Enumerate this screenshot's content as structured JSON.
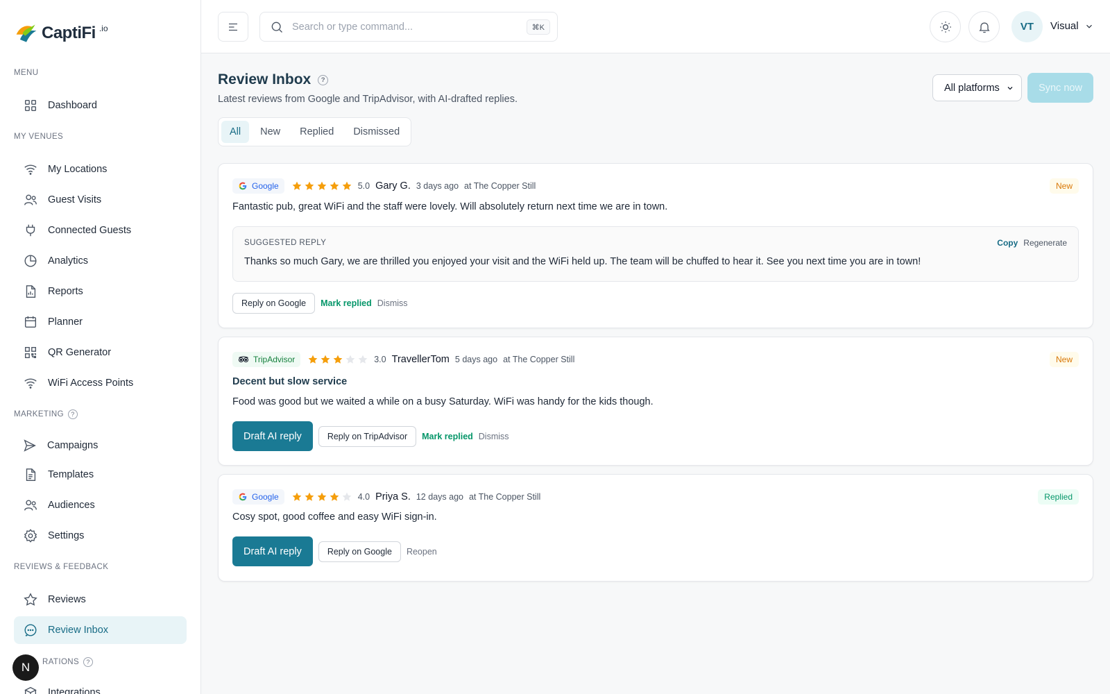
{
  "brand": {
    "name": "CaptiFi",
    "suffix": ".io"
  },
  "sidebar": {
    "sections": [
      {
        "label": "MENU"
      },
      {
        "label": "MY VENUES"
      },
      {
        "label": "MARKETING"
      },
      {
        "label": "REVIEWS & FEEDBACK"
      },
      {
        "label": "RATIONS"
      }
    ],
    "items": [
      {
        "label": "Dashboard",
        "icon": "grid-icon"
      },
      {
        "label": "My Locations",
        "icon": "wifi-icon"
      },
      {
        "label": "Guest Visits",
        "icon": "users-icon"
      },
      {
        "label": "Connected Guests",
        "icon": "plug-icon"
      },
      {
        "label": "Analytics",
        "icon": "pie-chart-icon"
      },
      {
        "label": "Reports",
        "icon": "report-icon"
      },
      {
        "label": "Planner",
        "icon": "calendar-icon"
      },
      {
        "label": "QR Generator",
        "icon": "qr-icon"
      },
      {
        "label": "WiFi Access Points",
        "icon": "wifi-icon"
      },
      {
        "label": "Campaigns",
        "icon": "send-icon"
      },
      {
        "label": "Templates",
        "icon": "template-icon"
      },
      {
        "label": "Audiences",
        "icon": "users-icon"
      },
      {
        "label": "Settings",
        "icon": "gear-icon"
      },
      {
        "label": "Reviews",
        "icon": "star-icon"
      },
      {
        "label": "Review Inbox",
        "icon": "chat-icon",
        "active": true
      },
      {
        "label": "Integrations",
        "icon": "box-icon"
      }
    ],
    "floating_badge": "N"
  },
  "topbar": {
    "search_placeholder": "Search or type command...",
    "shortcut": "⌘K",
    "avatar_initials": "VT",
    "user_name": "Visual"
  },
  "page": {
    "title": "Review Inbox",
    "help": "?",
    "subtitle": "Latest reviews from Google and TripAdvisor, with AI-drafted replies.",
    "platform_filter": "All platforms",
    "sync_label": "Sync now",
    "tabs": [
      {
        "label": "All",
        "active": true
      },
      {
        "label": "New"
      },
      {
        "label": "Replied"
      },
      {
        "label": "Dismissed"
      }
    ]
  },
  "reviews": [
    {
      "platform": "Google",
      "rating": 5,
      "rating_text": "5.0",
      "author": "Gary G.",
      "time": "3 days ago",
      "venue": "at The Copper Still",
      "status": "New",
      "text": "Fantastic pub, great WiFi and the staff were lovely. Will absolutely return next time we are in town.",
      "suggested_label": "SUGGESTED REPLY",
      "suggested_copy": "Copy",
      "suggested_regen": "Regenerate",
      "suggested_text": "Thanks so much Gary, we are thrilled you enjoyed your visit and the WiFi held up. The team will be chuffed to hear it. See you next time you are in town!",
      "reply_label": "Reply on Google",
      "mark_label": "Mark replied",
      "dismiss_label": "Dismiss"
    },
    {
      "platform": "TripAdvisor",
      "rating": 3,
      "rating_text": "3.0",
      "author": "TravellerTom",
      "time": "5 days ago",
      "venue": "at The Copper Still",
      "status": "New",
      "title": "Decent but slow service",
      "text": "Food was good but we waited a while on a busy Saturday. WiFi was handy for the kids though.",
      "draft_label": "Draft AI reply",
      "reply_label": "Reply on TripAdvisor",
      "mark_label": "Mark replied",
      "dismiss_label": "Dismiss"
    },
    {
      "platform": "Google",
      "rating": 4,
      "rating_text": "4.0",
      "author": "Priya S.",
      "time": "12 days ago",
      "venue": "at The Copper Still",
      "status": "Replied",
      "text": "Cosy spot, good coffee and easy WiFi sign-in.",
      "draft_label": "Draft AI reply",
      "reply_label": "Reply on Google",
      "reopen_label": "Reopen"
    }
  ],
  "colors": {
    "accent": "#1a7a94",
    "accent_light": "#e8f4f7",
    "star": "#f59e0b",
    "star_empty": "#e5e7eb",
    "new": "#d97706",
    "replied": "#059669"
  }
}
